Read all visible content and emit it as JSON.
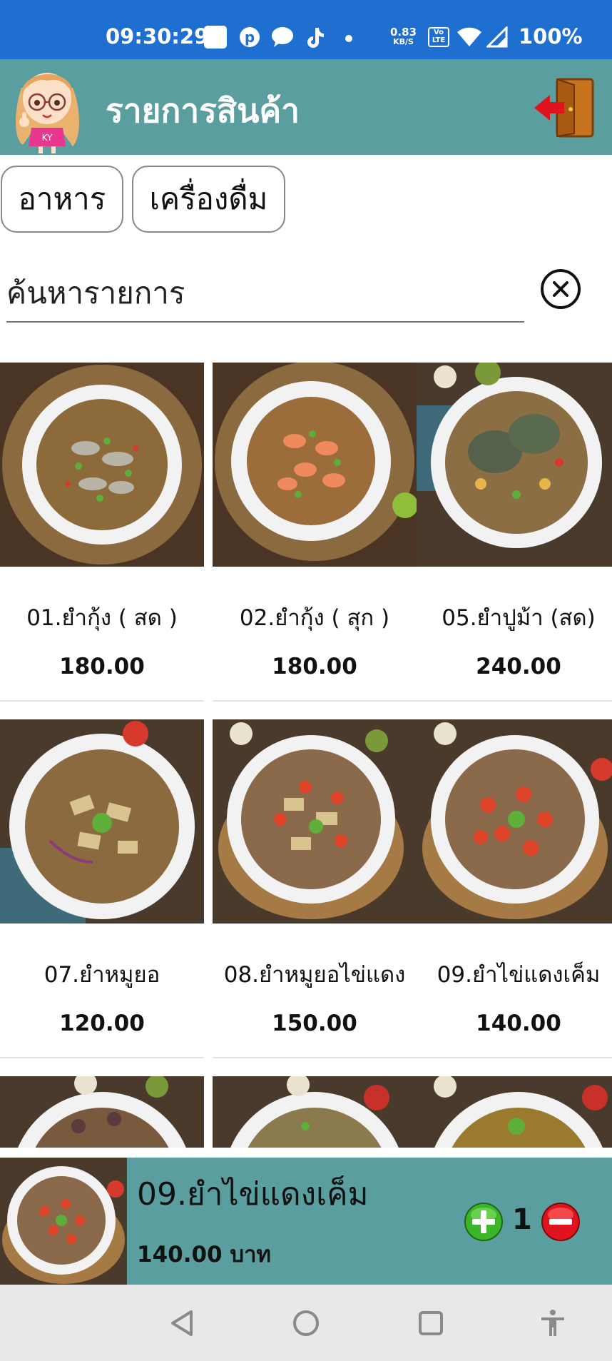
{
  "status_bar": {
    "time": "09:30:29",
    "net_speed": "0.83",
    "net_speed_unit": "KB/S",
    "volte": "Vo LTE",
    "battery": "100%",
    "icons": [
      "notification-square-icon",
      "pinterest-icon",
      "chat-bubble-icon",
      "tiktok-icon",
      "dot-icon",
      "wifi-icon",
      "signal-icon"
    ]
  },
  "header": {
    "title": "รายการสินค้า",
    "avatar_badge": "KY",
    "colors": {
      "background": "#5b9ea0",
      "title": "#ffffff"
    }
  },
  "tabs": [
    {
      "label": "อาหาร"
    },
    {
      "label": "เครื่องดื่ม"
    }
  ],
  "search": {
    "placeholder": "ค้นหารายการ"
  },
  "products": [
    {
      "name": "01.ยำกุ้ง ( สด )",
      "price": "180.00"
    },
    {
      "name": "02.ยำกุ้ง ( สุก )",
      "price": "180.00"
    },
    {
      "name": "05.ยำปูม้า (สด)",
      "price": "240.00"
    },
    {
      "name": "07.ยำหมูยอ",
      "price": "120.00"
    },
    {
      "name": "08.ยำหมูยอไข่แดง",
      "price": "150.00"
    },
    {
      "name": "09.ยำไข่แดงเค็ม",
      "price": "140.00"
    }
  ],
  "cart": {
    "item_name": "09.ยำไข่แดงเค็ม",
    "item_price": "140.00 บาท",
    "quantity": "1"
  },
  "colors": {
    "status_bar": "#1e6fd0",
    "accent": "#5b9ea0",
    "plus_button": "#3bb52a",
    "minus_button": "#e0141e"
  }
}
